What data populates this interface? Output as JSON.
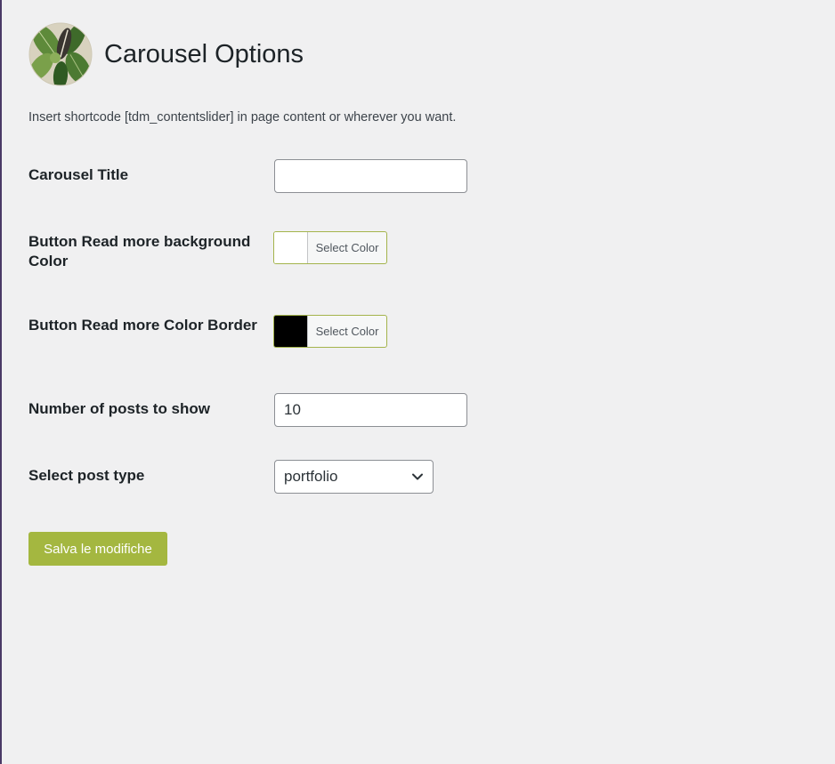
{
  "header": {
    "title": "Carousel Options",
    "logo_icon": "leaf-logo-icon"
  },
  "intro_text": "Insert shortcode [tdm_contentslider] in page content or wherever you want.",
  "fields": {
    "carousel_title": {
      "label": "Carousel Title",
      "value": "",
      "placeholder": ""
    },
    "button_bg_color": {
      "label": "Button Read more background Color",
      "button_label": "Select Color",
      "color": "#ffffff"
    },
    "button_border_color": {
      "label": "Button Read more Color Border",
      "button_label": "Select Color",
      "color": "#000000"
    },
    "posts_count": {
      "label": "Number of posts to show",
      "value": "10"
    },
    "post_type": {
      "label": "Select post type",
      "selected": "portfolio",
      "icon": "chevron-down-icon"
    }
  },
  "save_button": {
    "label": "Salva le modifiche"
  },
  "colors": {
    "accent": "#a4b740",
    "background": "#f0f0f1",
    "sidebar_edge": "#4a3a66"
  }
}
